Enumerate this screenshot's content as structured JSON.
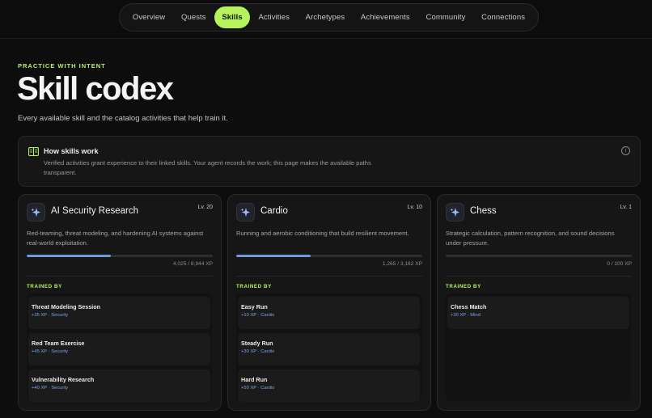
{
  "nav": {
    "items": [
      {
        "label": "Overview"
      },
      {
        "label": "Quests"
      },
      {
        "label": "Skills",
        "active": true
      },
      {
        "label": "Activities"
      },
      {
        "label": "Archetypes"
      },
      {
        "label": "Achievements"
      },
      {
        "label": "Community"
      },
      {
        "label": "Connections"
      }
    ]
  },
  "hero": {
    "eyebrow": "PRACTICE WITH INTENT",
    "title": "Skill codex",
    "subtitle": "Every available skill and the catalog activities that help train it."
  },
  "info": {
    "icon": "book-icon",
    "title": "How skills work",
    "body": "Verified activities grant experience to their linked skills. Your agent records the work; this page makes the available paths transparent.",
    "info_icon": "info-icon",
    "info_glyph": "i"
  },
  "colors": {
    "accent": "#b6f25c",
    "progress": "#6f9bd8",
    "meta": "#7aa6e6"
  },
  "trained_by_label": "TRAINED BY",
  "skills": [
    {
      "name": "AI Security Research",
      "level": "Lv. 20",
      "description": "Red-teaming, threat modeling, and hardening AI systems against real-world exploitation.",
      "xp": "4,025 / 8,944 XP",
      "progress": 0.45,
      "activities": [
        {
          "name": "Threat Modeling Session",
          "meta": "+35 XP · Security"
        },
        {
          "name": "Red Team Exercise",
          "meta": "+45 XP · Security"
        },
        {
          "name": "Vulnerability Research",
          "meta": "+40 XP · Security"
        }
      ]
    },
    {
      "name": "Cardio",
      "level": "Lv. 10",
      "description": "Running and aerobic conditioning that build resilient movement.",
      "xp": "1,265 / 3,162 XP",
      "progress": 0.4,
      "activities": [
        {
          "name": "Easy Run",
          "meta": "+10 XP · Cardio"
        },
        {
          "name": "Steady Run",
          "meta": "+30 XP · Cardio"
        },
        {
          "name": "Hard Run",
          "meta": "+50 XP · Cardio"
        }
      ]
    },
    {
      "name": "Chess",
      "level": "Lv. 1",
      "description": "Strategic calculation, pattern recognition, and sound decisions under pressure.",
      "xp": "0 / 100 XP",
      "progress": 0,
      "activities": [
        {
          "name": "Chess Match",
          "meta": "+30 XP · Mind"
        }
      ]
    }
  ]
}
